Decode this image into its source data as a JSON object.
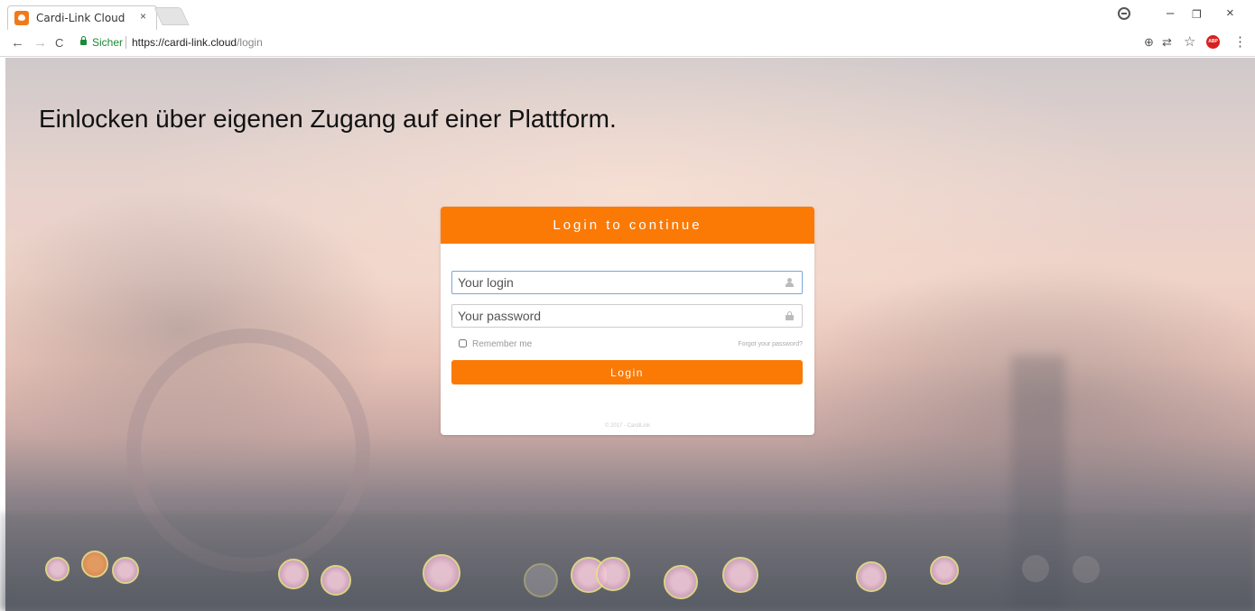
{
  "browser": {
    "tab_title": "Cardi-Link Cloud",
    "tab_close": "×",
    "nav": {
      "back": "←",
      "forward": "→",
      "reload": "C"
    },
    "security_label": "Sicher",
    "url_host": "https://cardi-link.cloud",
    "url_path": "/login",
    "window": {
      "minimize": "–",
      "restore": "❐",
      "close": "×"
    },
    "tools": {
      "zoom": "⊕",
      "translate": "⇄",
      "star": "☆",
      "abp": "ABP",
      "menu": "⋮"
    }
  },
  "page": {
    "headline": "Einlocken über eigenen Zugang auf einer Plattform."
  },
  "login": {
    "header": "Login to continue",
    "login_placeholder": "Your login",
    "password_placeholder": "Your password",
    "remember_label": "Remember me",
    "forgot_label": "Forgot your password?",
    "button_label": "Login",
    "footer": "© 2017 - CardiLink"
  },
  "colors": {
    "accent": "#fb7a05",
    "secure": "#1a8a34"
  }
}
